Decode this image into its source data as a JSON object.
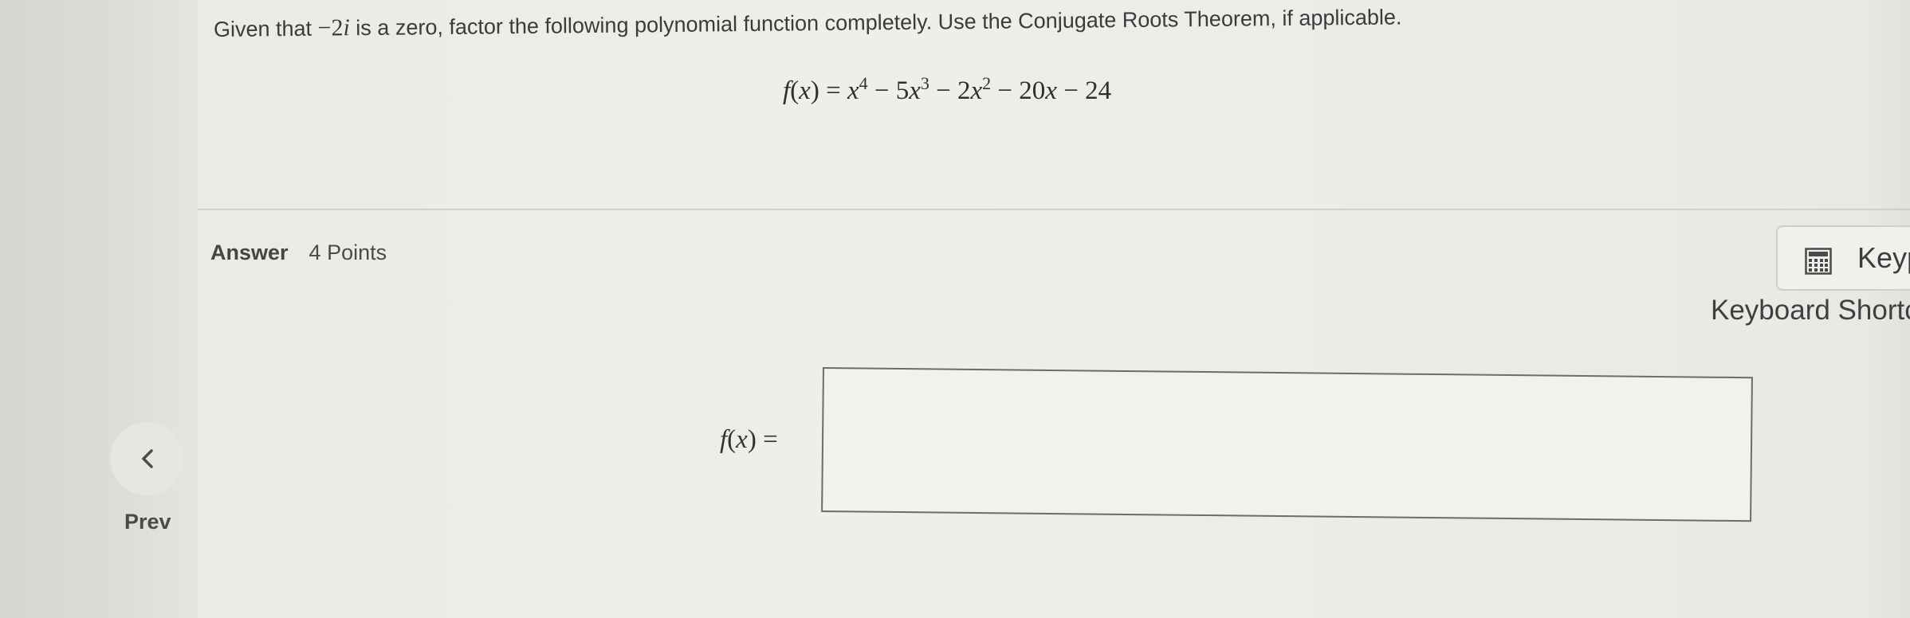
{
  "question": {
    "prefix": "Given that ",
    "minus": "−",
    "zero_value": "2",
    "zero_imag": "i",
    "suffix": " is a zero, factor the following polynomial function completely. Use the Conjugate Roots Theorem, if applicable."
  },
  "equation": {
    "fname": "f",
    "var": "x",
    "terms": {
      "t1_var": "x",
      "t1_exp": "4",
      "op1": " − ",
      "t2_coef": "5",
      "t2_var": "x",
      "t2_exp": "3",
      "op2": " − ",
      "t3_coef": "2",
      "t3_var": "x",
      "t3_exp": "2",
      "op3": " − ",
      "t4_coef": "20",
      "t4_var": "x",
      "op4": " − ",
      "t5_const": "24"
    }
  },
  "answer": {
    "label": "Answer",
    "points": "4 Points",
    "fx_fname": "f",
    "fx_var": "x",
    "fx_equals": " =",
    "input_value": ""
  },
  "toolbar": {
    "keypad_label": "Keypad",
    "keypad_icon": "calculator-icon",
    "shortcuts_label": "Keyboard Shortcuts"
  },
  "navigation": {
    "prev_label": "Prev",
    "prev_icon": "chevron-left-icon"
  }
}
